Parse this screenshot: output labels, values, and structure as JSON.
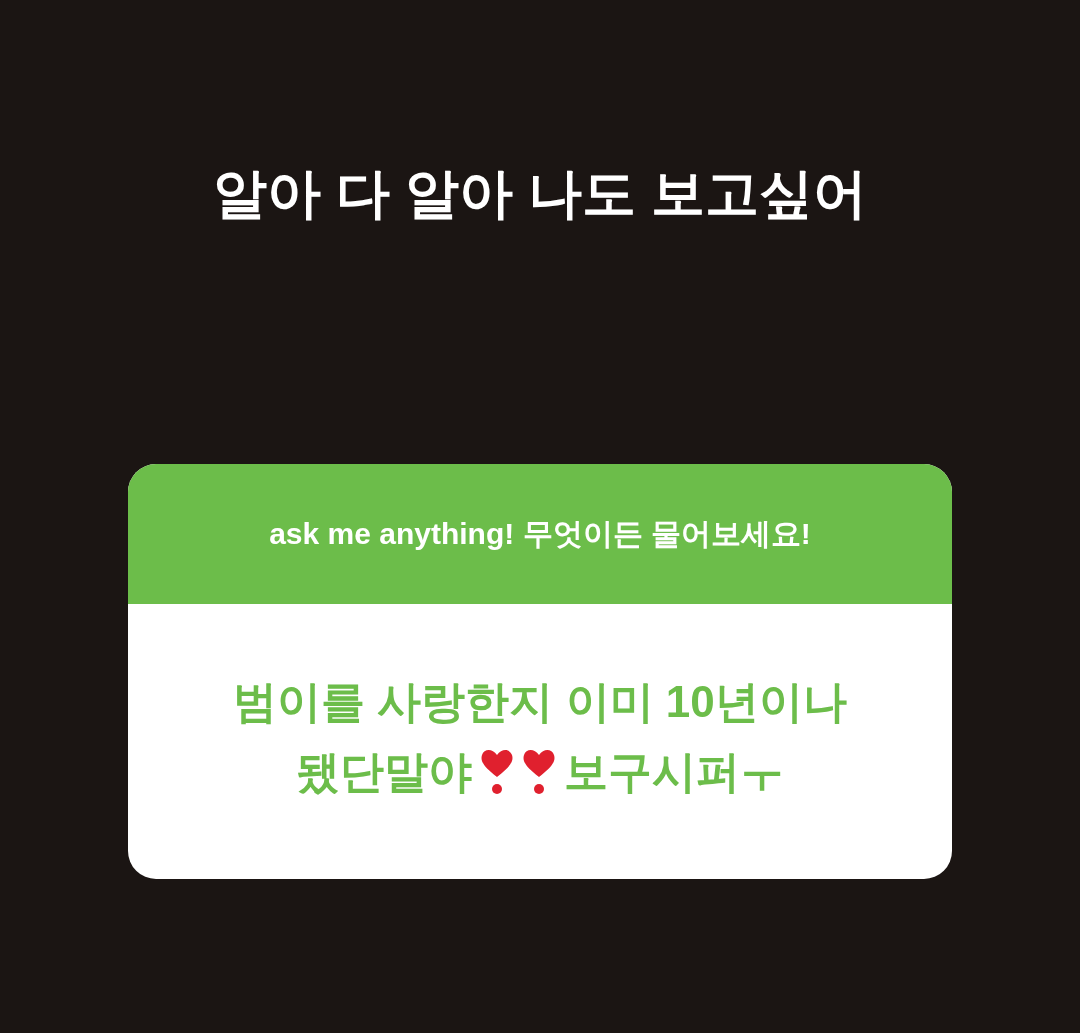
{
  "story_text": "알아 다 알아 나도 보고싶어",
  "question_sticker": {
    "prompt": "ask me anything! 무엇이든 물어보세요!",
    "answer_lines": [
      [
        {
          "kind": "text",
          "text": "범이를 사랑한지 이미 10년이나"
        }
      ],
      [
        {
          "kind": "text",
          "text": "됐단말야"
        },
        {
          "kind": "heart"
        },
        {
          "kind": "heart"
        },
        {
          "kind": "text",
          "text": "보구시퍼ㅜ"
        }
      ]
    ]
  }
}
